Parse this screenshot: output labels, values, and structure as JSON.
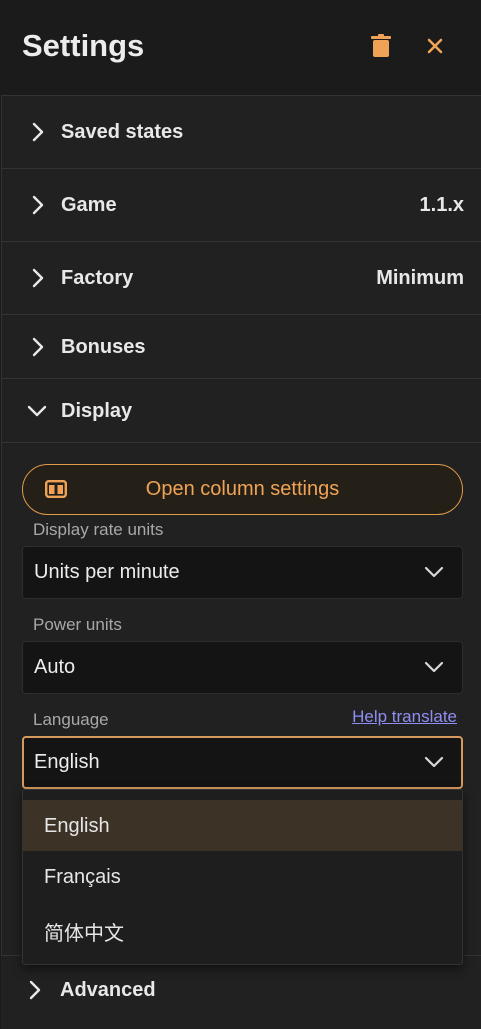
{
  "header": {
    "title": "Settings",
    "trash_icon": "trash-icon",
    "close_icon": "close-icon",
    "accent": "#f0a356"
  },
  "sections": [
    {
      "label": "Saved states",
      "value": "",
      "expanded": false
    },
    {
      "label": "Game",
      "value": "1.1.x",
      "expanded": false
    },
    {
      "label": "Factory",
      "value": "Minimum",
      "expanded": false
    },
    {
      "label": "Bonuses",
      "value": "",
      "expanded": false
    },
    {
      "label": "Display",
      "value": "",
      "expanded": true
    }
  ],
  "display": {
    "open_columns_label": "Open column settings",
    "rate_units_label": "Display rate units",
    "rate_units_value": "Units per minute",
    "power_units_label": "Power units",
    "power_units_value": "Auto",
    "language_label": "Language",
    "help_translate": "Help translate",
    "language_value": "English",
    "language_options": [
      "English",
      "Français",
      "简体中文"
    ],
    "language_selected": "English"
  },
  "advanced": {
    "label": "Advanced"
  }
}
